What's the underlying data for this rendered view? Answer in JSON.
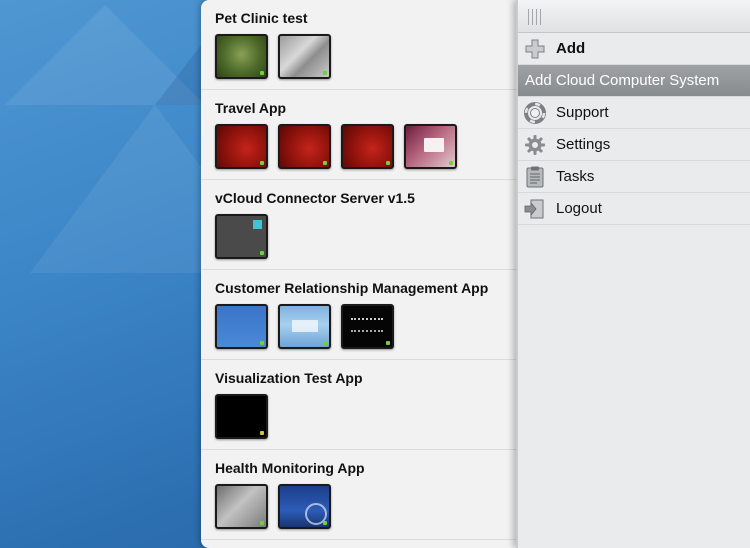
{
  "apps": [
    {
      "title": "Pet Clinic test",
      "thumbnails": [
        "green",
        "silver"
      ]
    },
    {
      "title": "Travel App",
      "thumbnails": [
        "red",
        "red",
        "red",
        "pinkish"
      ]
    },
    {
      "title": "vCloud Connector Server v1.5",
      "thumbnails": [
        "darkgray"
      ]
    },
    {
      "title": "Customer Relationship Management App",
      "thumbnails": [
        "winxp",
        "winlogin",
        "terminal"
      ]
    },
    {
      "title": "Visualization Test App",
      "thumbnails": [
        "black"
      ]
    },
    {
      "title": "Health Monitoring App",
      "thumbnails": [
        "grayscreen",
        "bluescreen"
      ]
    }
  ],
  "menu": {
    "add_label": "Add",
    "add_cloud_label": "Add Cloud Computer System",
    "support_label": "Support",
    "settings_label": "Settings",
    "tasks_label": "Tasks",
    "logout_label": "Logout"
  },
  "icons": {
    "add": "plus-icon",
    "support": "lifebuoy-icon",
    "settings": "gear-icon",
    "tasks": "clipboard-icon",
    "logout": "exit-door-icon"
  },
  "colors": {
    "background_blue": "#3c86c8",
    "selected_item": "#8e9194",
    "status_green": "#6fd13d"
  }
}
